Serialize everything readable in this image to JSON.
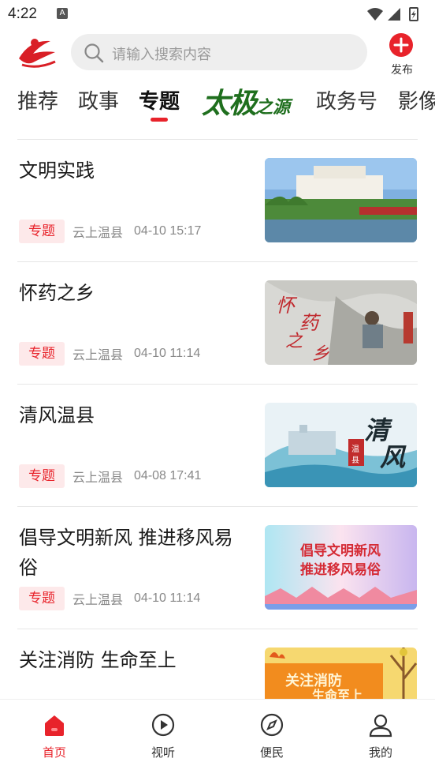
{
  "status_bar": {
    "time": "4:22",
    "notification_icon": "A"
  },
  "header": {
    "logo_icon": "app-logo",
    "search": {
      "placeholder": "请输入搜索内容"
    },
    "publish_label": "发布"
  },
  "tabs": {
    "items": [
      "推荐",
      "政事",
      "专题",
      "太极之源",
      "政务号",
      "影像"
    ],
    "active": "专题",
    "brand_tab": {
      "main": "太极",
      "suffix": "之源"
    }
  },
  "list": [
    {
      "title": "文明实践",
      "badge": "专题",
      "source": "云上温县",
      "time": "04-10 15:17",
      "thumb_text": ""
    },
    {
      "title": "怀药之乡",
      "badge": "专题",
      "source": "云上温县",
      "time": "04-10 11:14",
      "thumb_text": "怀药之乡"
    },
    {
      "title": "清风温县",
      "badge": "专题",
      "source": "云上温县",
      "time": "04-08 17:41",
      "thumb_text": "清风"
    },
    {
      "title": "倡导文明新风  推进移风易俗",
      "badge": "专题",
      "source": "云上温县",
      "time": "04-10 11:14",
      "thumb_text": "倡导文明新风 推进移风易俗"
    },
    {
      "title": "关注消防 生命至上",
      "badge": "",
      "source": "",
      "time": "",
      "thumb_text": "关注消防 生命至上"
    }
  ],
  "bottom_nav": {
    "items": [
      {
        "label": "首页",
        "icon": "home-icon",
        "active": true
      },
      {
        "label": "视听",
        "icon": "play-icon",
        "active": false
      },
      {
        "label": "便民",
        "icon": "compass-icon",
        "active": false
      },
      {
        "label": "我的",
        "icon": "user-icon",
        "active": false
      }
    ]
  },
  "colors": {
    "accent": "#e8232b",
    "brand_green": "#1f6f1e"
  }
}
